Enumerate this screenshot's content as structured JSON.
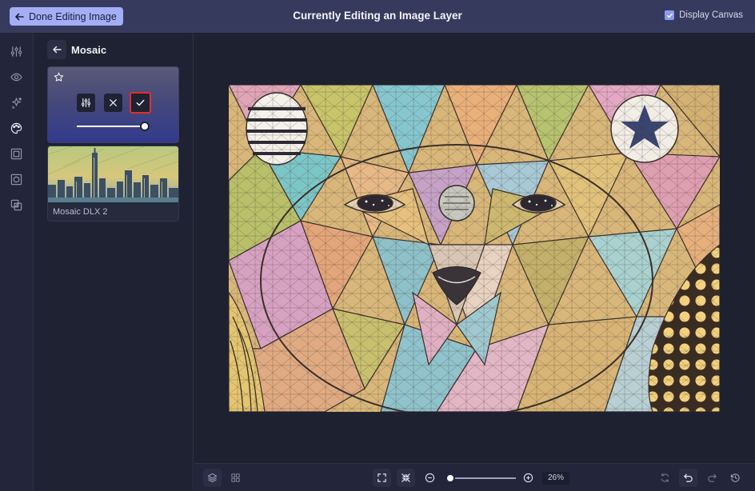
{
  "topbar": {
    "done_label": "Done Editing Image",
    "title": "Currently Editing an Image Layer",
    "display_canvas_label": "Display Canvas",
    "display_canvas_checked": true
  },
  "rail": {
    "icons": [
      "adjustments-icon",
      "eye-icon",
      "sparkles-icon",
      "palette-icon",
      "frame-icon",
      "mask-icon",
      "overlay-icon"
    ],
    "active_icon": "palette-icon"
  },
  "panel": {
    "title": "Mosaic",
    "active_filter": {
      "intensity_fraction": 0.98
    },
    "presets": [
      {
        "label": "Mosaic DLX 2"
      }
    ]
  },
  "bottombar": {
    "zoom_label": "26%",
    "zoom_fraction": 0.05
  },
  "colors": {
    "accent": "#a3aef5",
    "topbar_bg": "#363b5e",
    "app_bg": "#1e2130",
    "confirm_outline": "#e0302c"
  }
}
